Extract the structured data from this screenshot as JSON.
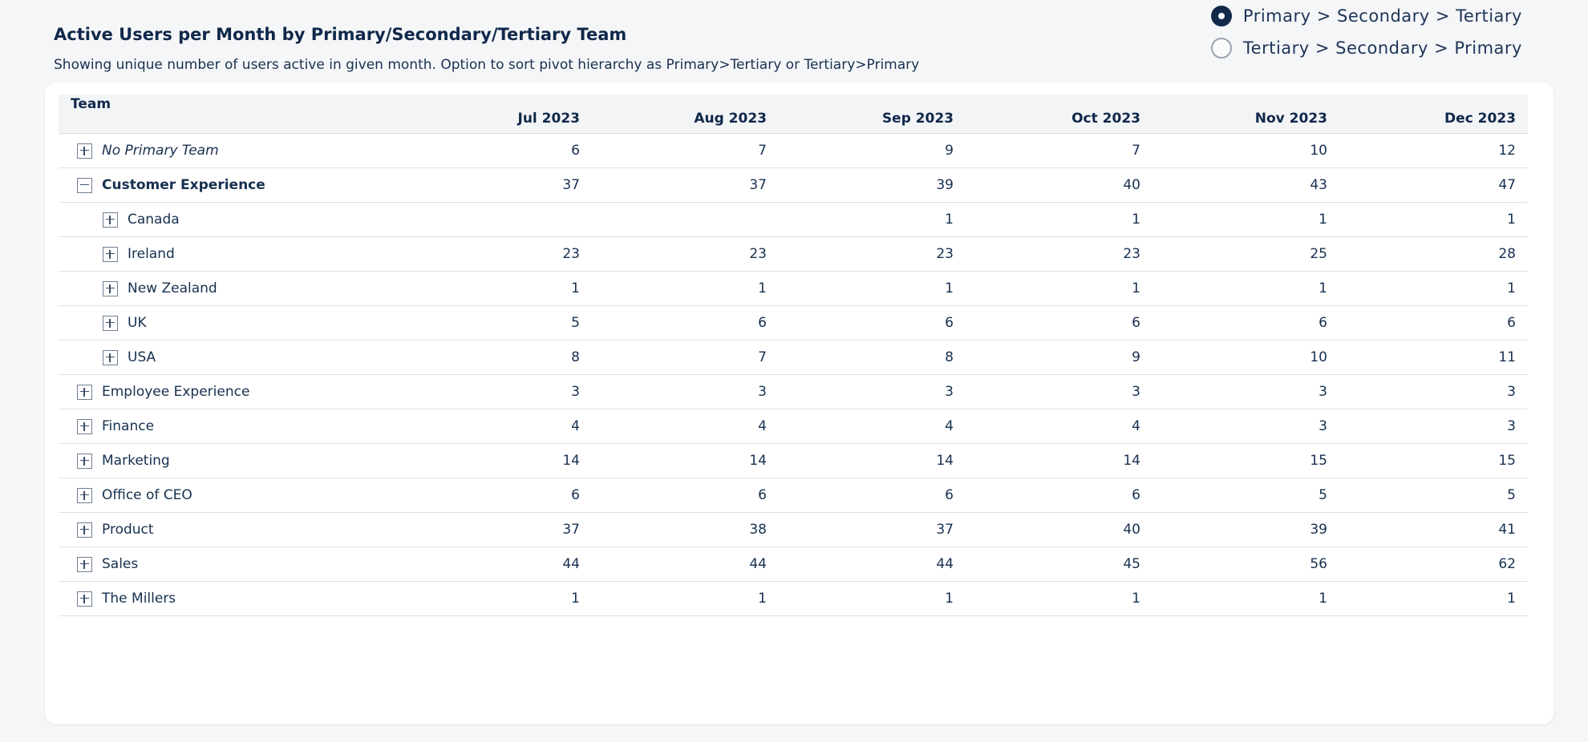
{
  "header": {
    "title": "Active Users per Month by Primary/Secondary/Tertiary Team",
    "subtitle": "Showing unique number of users active in given month. Option to sort pivot hierarchy as Primary>Tertiary or Tertiary>Primary"
  },
  "sort_options": [
    {
      "label": "Primary > Secondary > Tertiary",
      "checked": true
    },
    {
      "label": "Tertiary > Secondary > Primary",
      "checked": false
    }
  ],
  "table": {
    "team_header": "Team",
    "months": [
      "Jul 2023",
      "Aug 2023",
      "Sep 2023",
      "Oct 2023",
      "Nov 2023",
      "Dec 2023"
    ],
    "rows": [
      {
        "team": "No Primary Team",
        "level": 1,
        "expanded": false,
        "style": "italic",
        "values": [
          "6",
          "7",
          "9",
          "7",
          "10",
          "12"
        ]
      },
      {
        "team": "Customer Experience",
        "level": 1,
        "expanded": true,
        "style": "bold",
        "values": [
          "37",
          "37",
          "39",
          "40",
          "43",
          "47"
        ]
      },
      {
        "team": "Canada",
        "level": 2,
        "expanded": false,
        "style": "normal",
        "values": [
          "",
          "",
          "1",
          "1",
          "1",
          "1"
        ]
      },
      {
        "team": "Ireland",
        "level": 2,
        "expanded": false,
        "style": "normal",
        "values": [
          "23",
          "23",
          "23",
          "23",
          "25",
          "28"
        ]
      },
      {
        "team": "New Zealand",
        "level": 2,
        "expanded": false,
        "style": "normal",
        "values": [
          "1",
          "1",
          "1",
          "1",
          "1",
          "1"
        ]
      },
      {
        "team": "UK",
        "level": 2,
        "expanded": false,
        "style": "normal",
        "values": [
          "5",
          "6",
          "6",
          "6",
          "6",
          "6"
        ]
      },
      {
        "team": "USA",
        "level": 2,
        "expanded": false,
        "style": "normal",
        "values": [
          "8",
          "7",
          "8",
          "9",
          "10",
          "11"
        ]
      },
      {
        "team": "Employee Experience",
        "level": 1,
        "expanded": false,
        "style": "normal",
        "values": [
          "3",
          "3",
          "3",
          "3",
          "3",
          "3"
        ]
      },
      {
        "team": "Finance",
        "level": 1,
        "expanded": false,
        "style": "normal",
        "values": [
          "4",
          "4",
          "4",
          "4",
          "3",
          "3"
        ]
      },
      {
        "team": "Marketing",
        "level": 1,
        "expanded": false,
        "style": "normal",
        "values": [
          "14",
          "14",
          "14",
          "14",
          "15",
          "15"
        ]
      },
      {
        "team": "Office of CEO",
        "level": 1,
        "expanded": false,
        "style": "normal",
        "values": [
          "6",
          "6",
          "6",
          "6",
          "5",
          "5"
        ]
      },
      {
        "team": "Product",
        "level": 1,
        "expanded": false,
        "style": "normal",
        "values": [
          "37",
          "38",
          "37",
          "40",
          "39",
          "41"
        ]
      },
      {
        "team": "Sales",
        "level": 1,
        "expanded": false,
        "style": "normal",
        "values": [
          "44",
          "44",
          "44",
          "45",
          "56",
          "62"
        ]
      },
      {
        "team": "The Millers",
        "level": 1,
        "expanded": false,
        "style": "normal",
        "values": [
          "1",
          "1",
          "1",
          "1",
          "1",
          "1"
        ]
      }
    ]
  }
}
